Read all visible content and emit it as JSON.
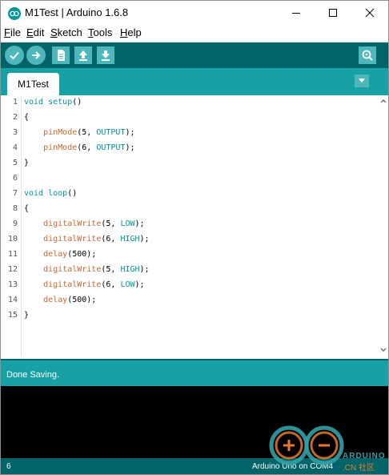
{
  "window": {
    "title": "M1Test | Arduino 1.6.8",
    "icon": "arduino-logo-icon"
  },
  "menubar": {
    "items": [
      {
        "key": "F",
        "rest": "ile"
      },
      {
        "key": "E",
        "rest": "dit"
      },
      {
        "key": "S",
        "rest": "ketch"
      },
      {
        "key": "T",
        "rest": "ools"
      },
      {
        "key": "H",
        "rest": "elp"
      }
    ]
  },
  "toolbar": {
    "buttons": [
      "verify-icon",
      "upload-icon",
      "new-icon",
      "open-icon",
      "save-icon",
      "serial-monitor-icon"
    ]
  },
  "tabs": {
    "active": "M1Test"
  },
  "editor": {
    "lines": [
      "void setup()",
      "{",
      "    pinMode(5, OUTPUT);",
      "    pinMode(6, OUTPUT);",
      "}",
      "",
      "void loop()",
      "{",
      "    digitalWrite(5, LOW);",
      "    digitalWrite(6, HIGH);",
      "    delay(500);",
      "    digitalWrite(5, HIGH);",
      "    digitalWrite(6, LOW);",
      "    delay(500);",
      "}"
    ]
  },
  "status": {
    "message": "Done Saving."
  },
  "bottom": {
    "line_number": "6",
    "board": "Arduino Uno on COM4"
  },
  "watermark": {
    "title": "ARDUINO",
    "subtitle": ".CN 社区"
  },
  "colors": {
    "toolbar": "#006468",
    "tabbar": "#17a1a5",
    "button": "#4db7bb",
    "keyword": "#00979c",
    "function": "#cc6633"
  }
}
